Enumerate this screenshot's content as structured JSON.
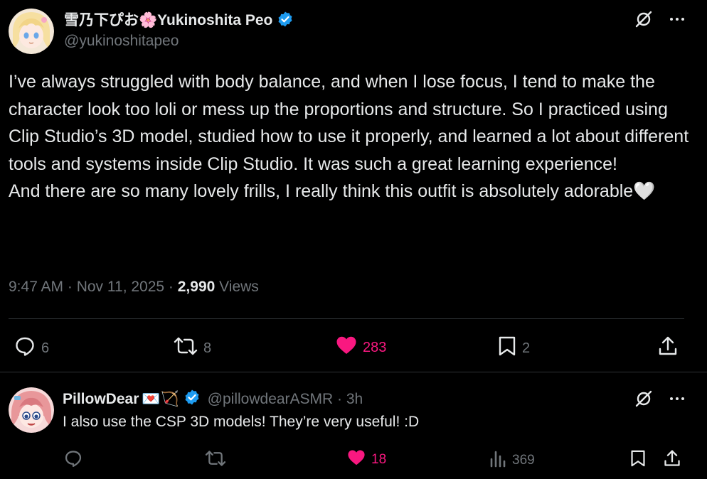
{
  "tweet": {
    "display_name": "雪乃下ぴお🌸Yukinoshita Peo",
    "handle": "@yukinoshitapeo",
    "text": "I’ve always struggled with body balance, and when I lose focus, I tend to make the character look too loli or mess up the proportions and structure. So I practiced using Clip Studio’s 3D model, studied how to use it properly, and learned a lot about different tools and systems inside Clip Studio. It was such a great learning experience!\nAnd there are so many lovely frills, I really think this outfit is absolutely adorable🤍",
    "time": "9:47 AM · Nov 11, 2025 · ",
    "views_count": "2,990",
    "views_label": " Views",
    "replies": "6",
    "reposts": "8",
    "likes": "283",
    "bookmarks": "2"
  },
  "reply": {
    "display_name": "PillowDear",
    "emojis": "💌🏹",
    "handle": "@pillowdearASMR · 3h",
    "text": "I also use the CSP 3D models! They’re very useful! :D",
    "likes": "18",
    "views": "369"
  },
  "colors": {
    "background": "#000000",
    "text": "#e7e9ea",
    "muted": "#71767b",
    "like": "#f91880",
    "verified": "#1d9bf0",
    "divider": "#2f3336"
  },
  "icons": {
    "grok": "grok-icon",
    "more": "more-icon",
    "reply": "reply-icon",
    "repost": "repost-icon",
    "like": "heart-icon",
    "bookmark": "bookmark-icon",
    "share": "share-icon",
    "views": "views-icon",
    "verified": "verified-badge-icon"
  }
}
